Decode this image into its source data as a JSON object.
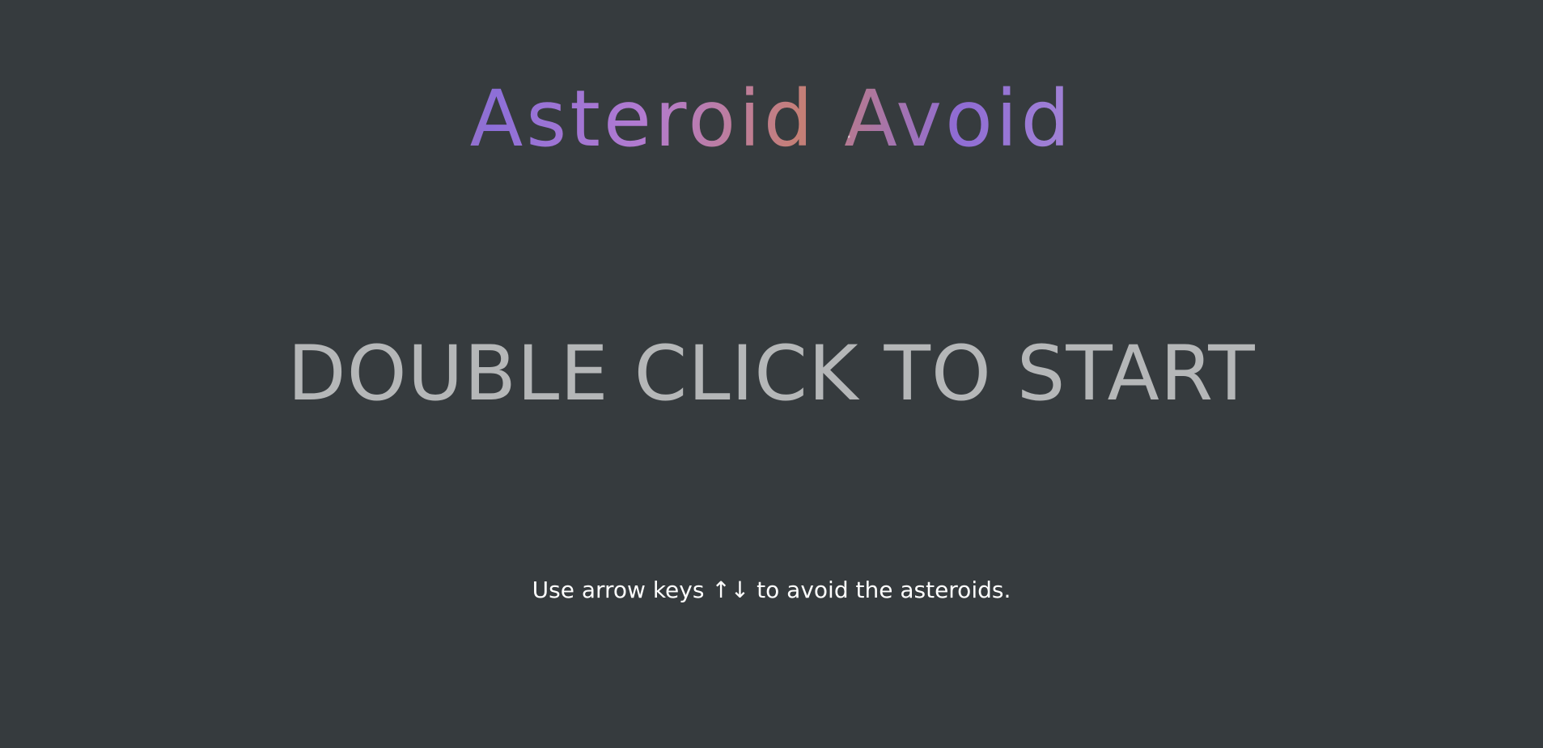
{
  "game": {
    "title": "Asteroid Avoid",
    "start_prompt": "DOUBLE CLICK TO START",
    "instructions": "Use arrow keys ↑↓ to avoid the asteroids."
  },
  "colors": {
    "background": "#363b3e",
    "start_prompt": "#b5b7b8",
    "instructions": "#ffffff",
    "title_nebula": [
      "#9a74d8",
      "#c97f6c",
      "#8d6fd8"
    ]
  }
}
